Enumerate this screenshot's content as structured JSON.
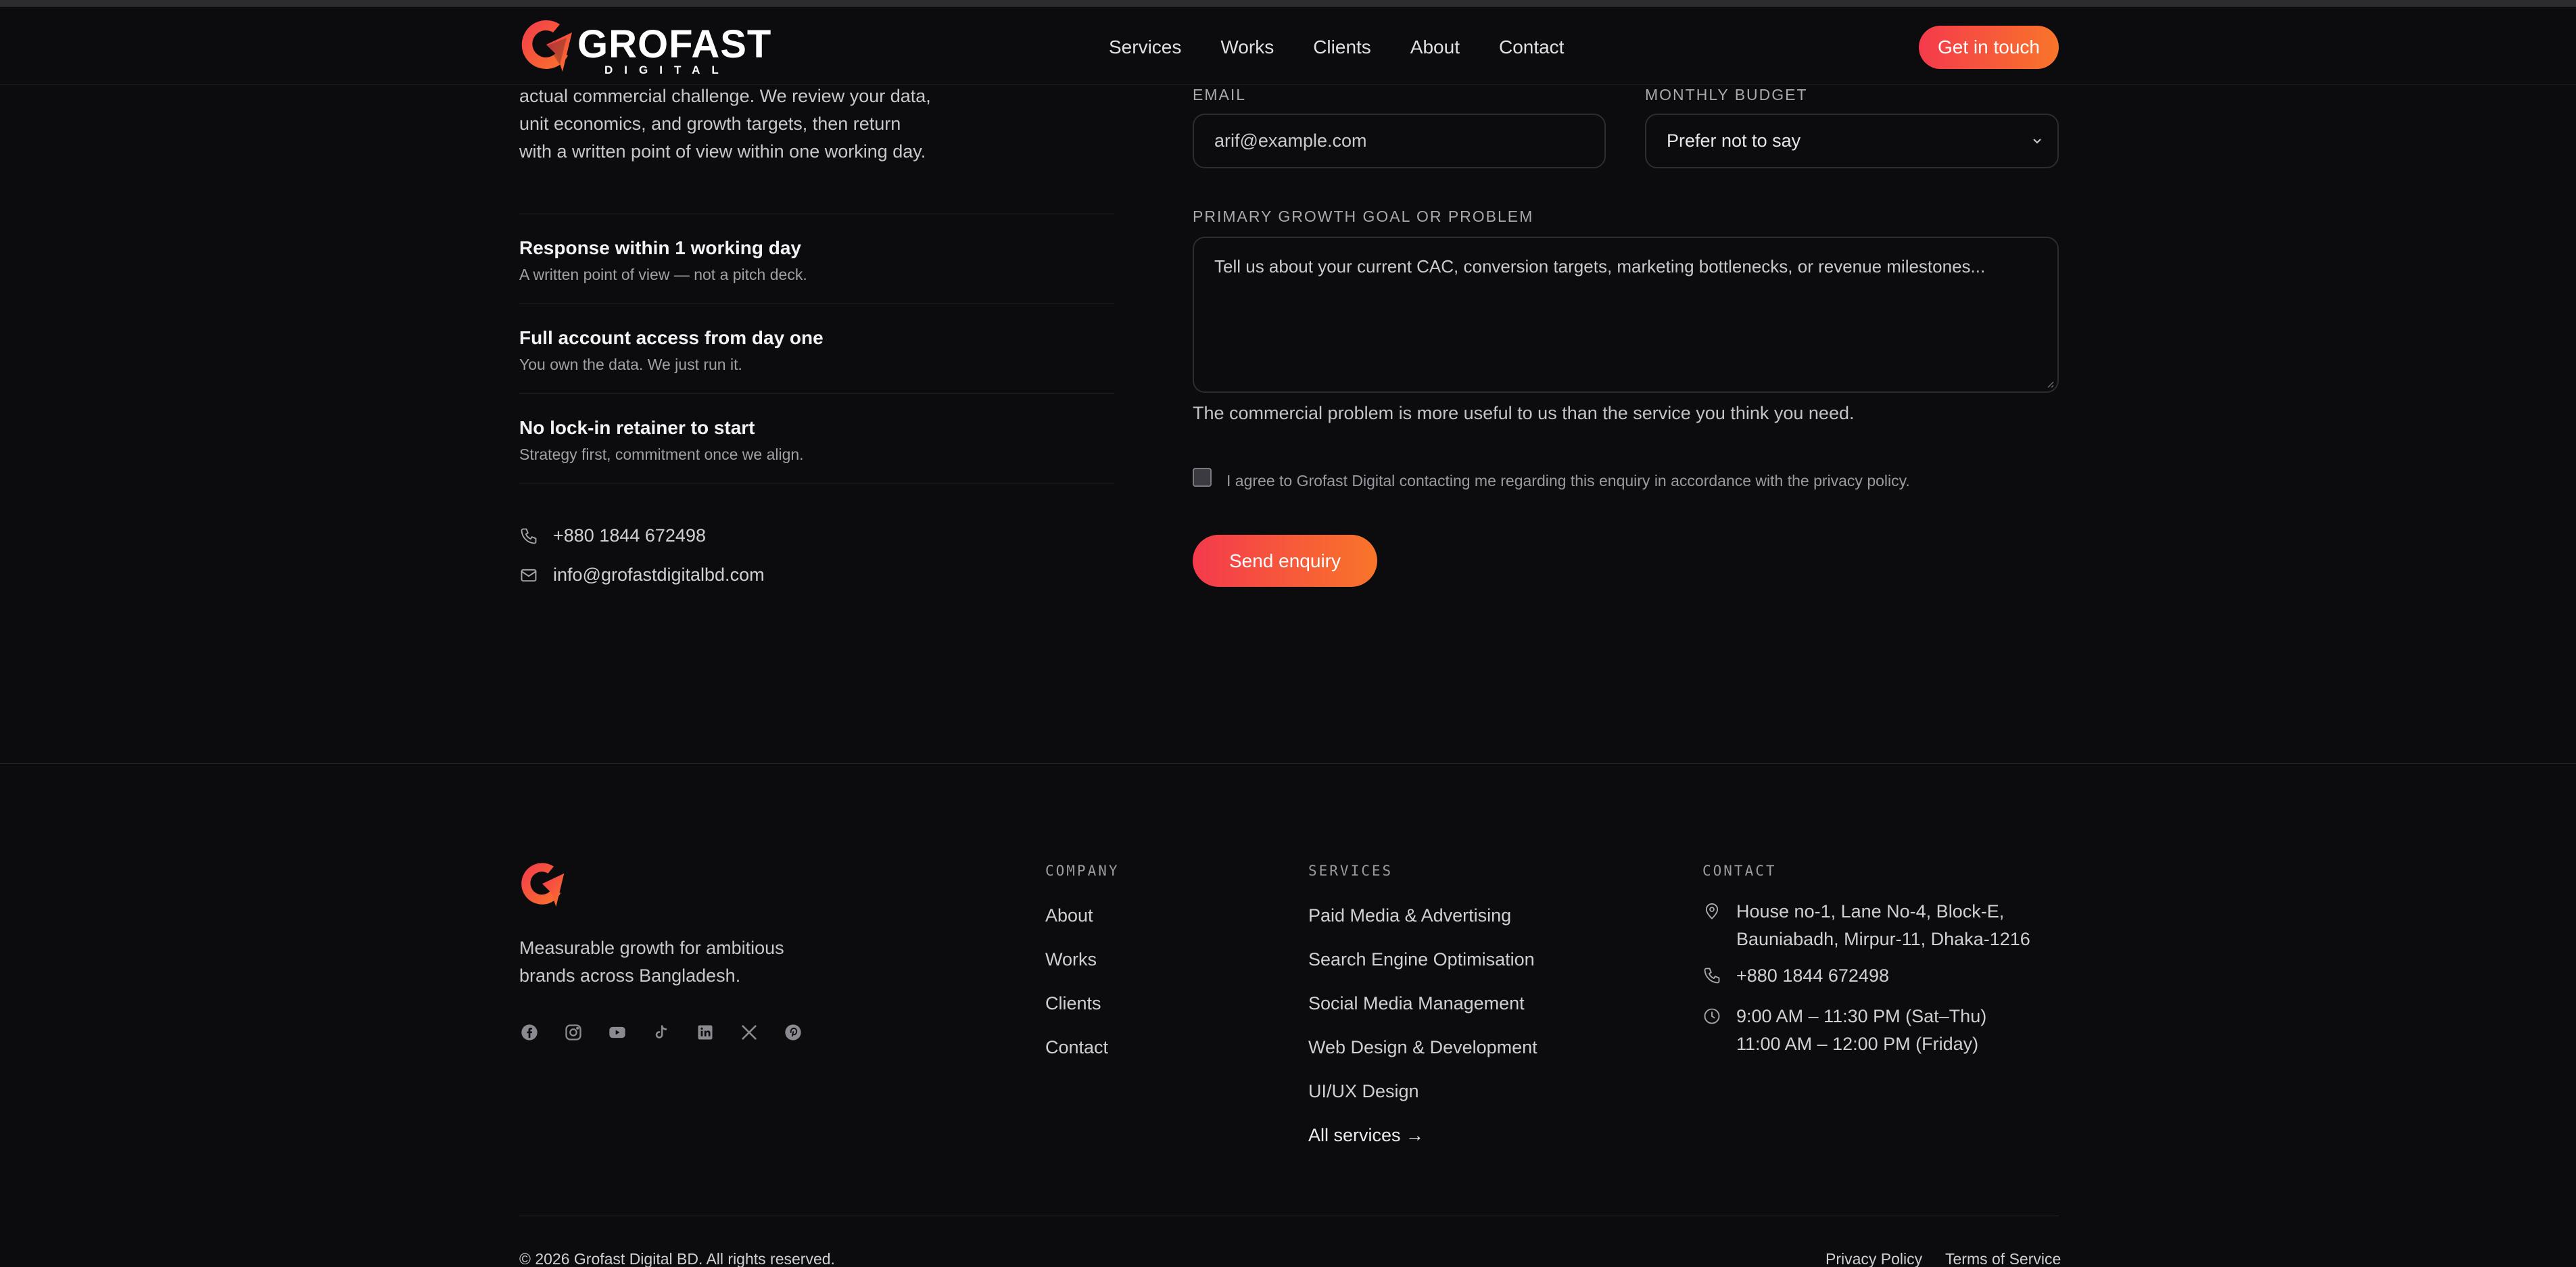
{
  "brand": {
    "name": "GROFAST",
    "sub": "DIGITAL",
    "accent_start": "#f43a4c",
    "accent_end": "#f9752a"
  },
  "nav": {
    "items": [
      "Services",
      "Works",
      "Clients",
      "About",
      "Contact"
    ],
    "cta": "Get in touch"
  },
  "intro": {
    "lines": [
      "actual commercial challenge. We review your data,",
      "unit economics, and growth targets, then return",
      "with a written point of view within one working day."
    ]
  },
  "features": [
    {
      "title": "Response within 1 working day",
      "desc": "A written point of view — not a pitch deck."
    },
    {
      "title": "Full account access from day one",
      "desc": "You own the data. We just run it."
    },
    {
      "title": "No lock-in retainer to start",
      "desc": "Strategy first, commitment once we align."
    }
  ],
  "contact": {
    "phone": "+880 1844 672498",
    "email": "info@grofastdigitalbd.com"
  },
  "form": {
    "email_label": "EMAIL",
    "email_value": "arif@example.com",
    "budget_label": "MONTHLY BUDGET",
    "budget_value": "Prefer not to say",
    "goal_label": "PRIMARY GROWTH GOAL OR PROBLEM",
    "goal_placeholder": "Tell us about your current CAC, conversion targets, marketing bottlenecks, or revenue milestones...",
    "helper": "The commercial problem is more useful to us than the service you think you need.",
    "consent": "I agree to Grofast Digital contacting me regarding this enquiry in accordance with the privacy policy.",
    "submit": "Send enquiry"
  },
  "footer": {
    "tagline": "Measurable growth for ambitious brands across Bangladesh.",
    "socials": [
      "facebook-icon",
      "instagram-icon",
      "youtube-icon",
      "tiktok-icon",
      "linkedin-icon",
      "x-icon",
      "pinterest-icon"
    ],
    "company_head": "COMPANY",
    "company": [
      "About",
      "Works",
      "Clients",
      "Contact"
    ],
    "services_head": "SERVICES",
    "services": [
      "Paid Media & Advertising",
      "Search Engine Optimisation",
      "Social Media Management",
      "Web Design & Development",
      "UI/UX Design"
    ],
    "services_all": "All services →",
    "contact_head": "CONTACT",
    "address_lines": [
      "House no-1, Lane No-4, Block-E,",
      "Bauniabadh, Mirpur-11, Dhaka-1216"
    ],
    "phone": "+880 1844 672498",
    "hours_lines": [
      "9:00 AM – 11:30 PM (Sat–Thu)",
      "11:00 AM – 12:00 PM (Friday)"
    ],
    "copyright": "© 2026 Grofast Digital BD. All rights reserved.",
    "privacy": "Privacy Policy",
    "terms": "Terms of Service"
  }
}
